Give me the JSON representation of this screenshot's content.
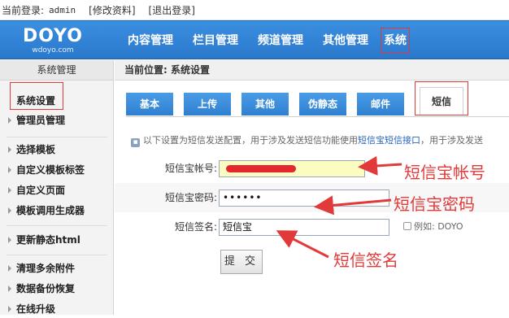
{
  "topbar": {
    "login_label": "当前登录:",
    "username": "admin",
    "edit_profile": "[修改资料]",
    "logout": "[退出登录]"
  },
  "header": {
    "logo_main": "DOYO",
    "logo_sub": "wdoyo.com",
    "nav": [
      "内容管理",
      "栏目管理",
      "频道管理",
      "其他管理",
      "系统"
    ]
  },
  "sidebar": {
    "title": "系统管理",
    "items": [
      "系统设置",
      "管理员管理",
      "选择模板",
      "自定义模板标签",
      "自定义页面",
      "模板调用生成器",
      "更新静态html",
      "清理多余附件",
      "数据备份恢复",
      "在线升级"
    ]
  },
  "main": {
    "breadcrumb": "当前位置: 系统设置",
    "tabs": [
      "基本",
      "上传",
      "其他",
      "伪静态",
      "邮件",
      "短信"
    ],
    "notice_prefix": "以下设置为短信发送配置，用于涉及发送短信功能使用",
    "notice_link": "短信宝短信接口",
    "notice_suffix": "，用于涉及发送",
    "form": {
      "account_label": "短信宝帐号:",
      "password_label": "短信宝密码:",
      "password_value": "••••••",
      "sign_label": "短信签名:",
      "sign_value": "短信宝",
      "sign_hint": "例如: DOYO",
      "submit": "提 交"
    }
  },
  "annotations": {
    "account": "短信宝帐号",
    "password": "短信宝密码",
    "sign": "短信签名"
  },
  "colors": {
    "nav_blue": "#2a78cc",
    "annotation_red": "#e23a3a",
    "account_field_bg": "#fdfcc0"
  }
}
